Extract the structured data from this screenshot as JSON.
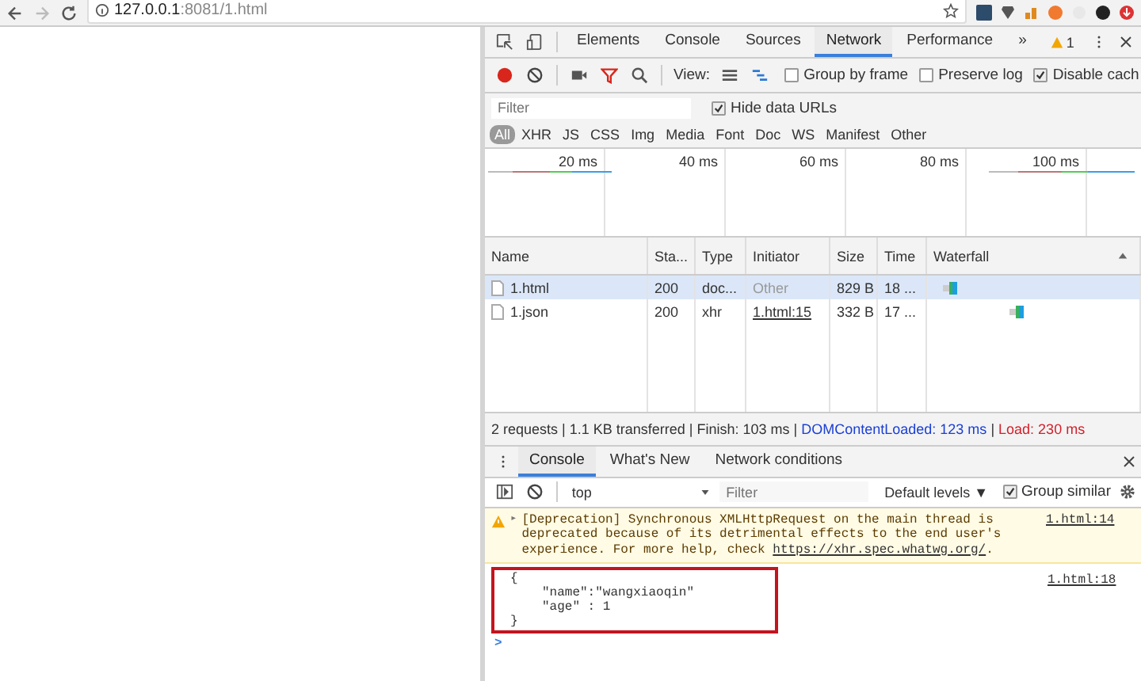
{
  "address_bar": {
    "host": "127.0.0.1",
    "path": ":8081/1.html"
  },
  "devtools": {
    "tabs": [
      {
        "label": "Elements",
        "selected": false
      },
      {
        "label": "Console",
        "selected": false
      },
      {
        "label": "Sources",
        "selected": false
      },
      {
        "label": "Network",
        "selected": true
      },
      {
        "label": "Performance",
        "selected": false
      }
    ],
    "more": "»",
    "warning_count": "1"
  },
  "network_toolbar": {
    "recording": true,
    "view_label": "View:",
    "options": [
      {
        "label": "Group by frame",
        "checked": false
      },
      {
        "label": "Preserve log",
        "checked": false
      },
      {
        "label": "Disable cach",
        "checked": true
      }
    ]
  },
  "filter": {
    "placeholder": "Filter",
    "hide_data_urls": {
      "label": "Hide data URLs",
      "checked": true
    }
  },
  "types": [
    {
      "label": "All",
      "selected": true
    },
    {
      "label": "XHR",
      "selected": false
    },
    {
      "label": "JS",
      "selected": false
    },
    {
      "label": "CSS",
      "selected": false
    },
    {
      "label": "Img",
      "selected": false
    },
    {
      "label": "Media",
      "selected": false
    },
    {
      "label": "Font",
      "selected": false
    },
    {
      "label": "Doc",
      "selected": false
    },
    {
      "label": "WS",
      "selected": false
    },
    {
      "label": "Manifest",
      "selected": false
    },
    {
      "label": "Other",
      "selected": false
    }
  ],
  "overview_ticks": [
    "20 ms",
    "40 ms",
    "60 ms",
    "80 ms",
    "100 ms"
  ],
  "table": {
    "columns": [
      "Name",
      "Sta...",
      "Type",
      "Initiator",
      "Size",
      "Time",
      "Waterfall"
    ],
    "rows": [
      {
        "name": "1.html",
        "status": "200",
        "type": "doc...",
        "initiator": "Other",
        "initiator_link": false,
        "size": "829 B",
        "time": "18 ...",
        "selected": true
      },
      {
        "name": "1.json",
        "status": "200",
        "type": "xhr",
        "initiator": "1.html:15",
        "initiator_link": true,
        "size": "332 B",
        "time": "17 ...",
        "selected": false
      }
    ]
  },
  "status_bar": [
    {
      "text": "2 requests | 1.1 KB transferred | Finish: 103 ms | ",
      "kind": "plain"
    },
    {
      "text": "DOMContentLoaded: 123 ms",
      "kind": "blue"
    },
    {
      "text": " | ",
      "kind": "plain"
    },
    {
      "text": "Load: 230 ms",
      "kind": "red"
    }
  ],
  "drawer_tabs": [
    {
      "label": "Console",
      "selected": true
    },
    {
      "label": "What's New",
      "selected": false
    },
    {
      "label": "Network conditions",
      "selected": false
    }
  ],
  "console_toolbar": {
    "context": "top",
    "filter_placeholder": "Filter",
    "levels": "Default levels ▼",
    "group_similar": {
      "label": "Group similar",
      "checked": true
    }
  },
  "messages": [
    {
      "kind": "warning",
      "expander": "▸",
      "text": "[Deprecation] Synchronous XMLHttpRequest on the main thread is deprecated because of its detrimental effects to the end user's experience. For more help, check ",
      "link": "https://xhr.spec.whatwg.org/",
      "after": ".",
      "source": "1.html:14"
    },
    {
      "kind": "log",
      "lines": [
        "{",
        "\"name\":\"wangxiaoqin\"",
        "\"age\" : 1",
        "}"
      ],
      "source": "1.html:18",
      "highlighted": true
    }
  ],
  "prompt": ">"
}
